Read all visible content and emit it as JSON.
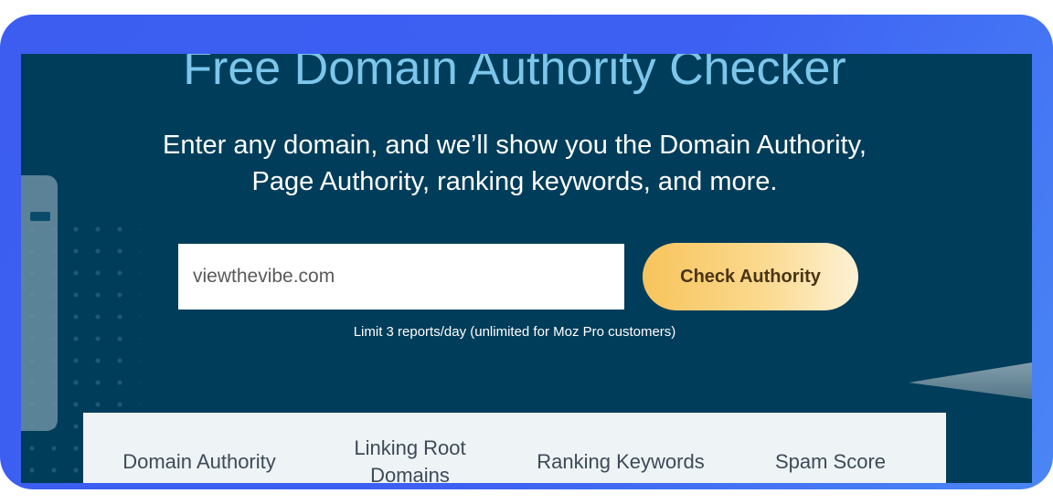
{
  "page": {
    "title": "Free Domain Authority Checker",
    "subtitle_line1": "Enter any domain, and we’ll show you the Domain Authority,",
    "subtitle_line2": "Page Authority, ranking keywords, and more."
  },
  "search": {
    "value": "viewthevibe.com",
    "button_label": "Check Authority",
    "limit_note": "Limit 3 reports/day (unlimited for Moz Pro customers)"
  },
  "metrics": {
    "domain_authority": "Domain Authority",
    "linking_root_domains": "Linking Root Domains",
    "ranking_keywords": "Ranking Keywords",
    "spam_score": "Spam Score"
  },
  "colors": {
    "frame": "#3c5df0",
    "background": "#003d5a",
    "title": "#7cc6ec",
    "button": "#f7c45c"
  }
}
